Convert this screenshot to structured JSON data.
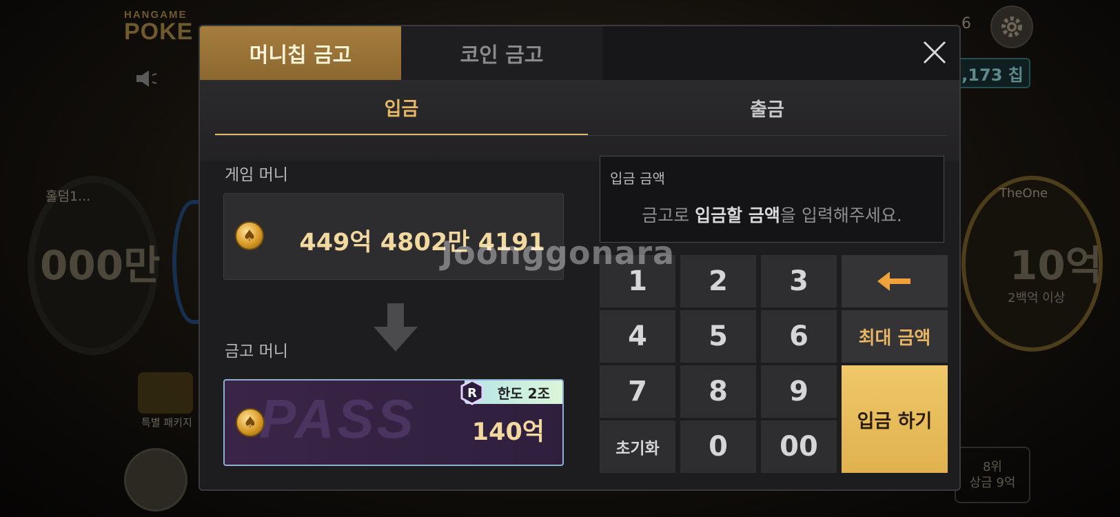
{
  "background": {
    "logo_small": "HANGAME",
    "logo_big": "POKE",
    "top_right_number": "6",
    "chip_pill": ",173 칩",
    "left_label": "홀덤1...",
    "left_big": "000만",
    "right_label": "TheOne",
    "right_big": "10억",
    "right_sub": "2백억 이상",
    "gift_label": "특별 패키지",
    "rank_line1": "8위",
    "rank_line2": "상금 9억"
  },
  "tabs": {
    "money_chip_vault": "머니칩 금고",
    "coin_vault": "코인 금고"
  },
  "subtabs": {
    "deposit": "입금",
    "withdraw": "출금"
  },
  "game_money": {
    "label": "게임 머니",
    "value": "449억 4802만 4191"
  },
  "vault_money": {
    "label": "금고 머니",
    "value": "140억",
    "limit_badge": "한도 2조",
    "pass_text": "PASS"
  },
  "deposit_amount": {
    "label": "입금 금액",
    "placeholder_pre": "금고로 ",
    "placeholder_bold": "입금할 금액",
    "placeholder_post": "을 입력해주세요."
  },
  "keypad": {
    "k1": "1",
    "k2": "2",
    "k3": "3",
    "k4": "4",
    "k5": "5",
    "k6": "6",
    "k7": "7",
    "k8": "8",
    "k9": "9",
    "reset": "초기화",
    "k0": "0",
    "k00": "00",
    "max_amount": "최대 금액",
    "submit": "입금 하기"
  },
  "watermark": "Joonggonara",
  "colors": {
    "gold_accent": "#e6b865",
    "active_tab": "#a57d3e",
    "submit_button": "#e9bd5c",
    "panel": "#1d1c1f"
  }
}
